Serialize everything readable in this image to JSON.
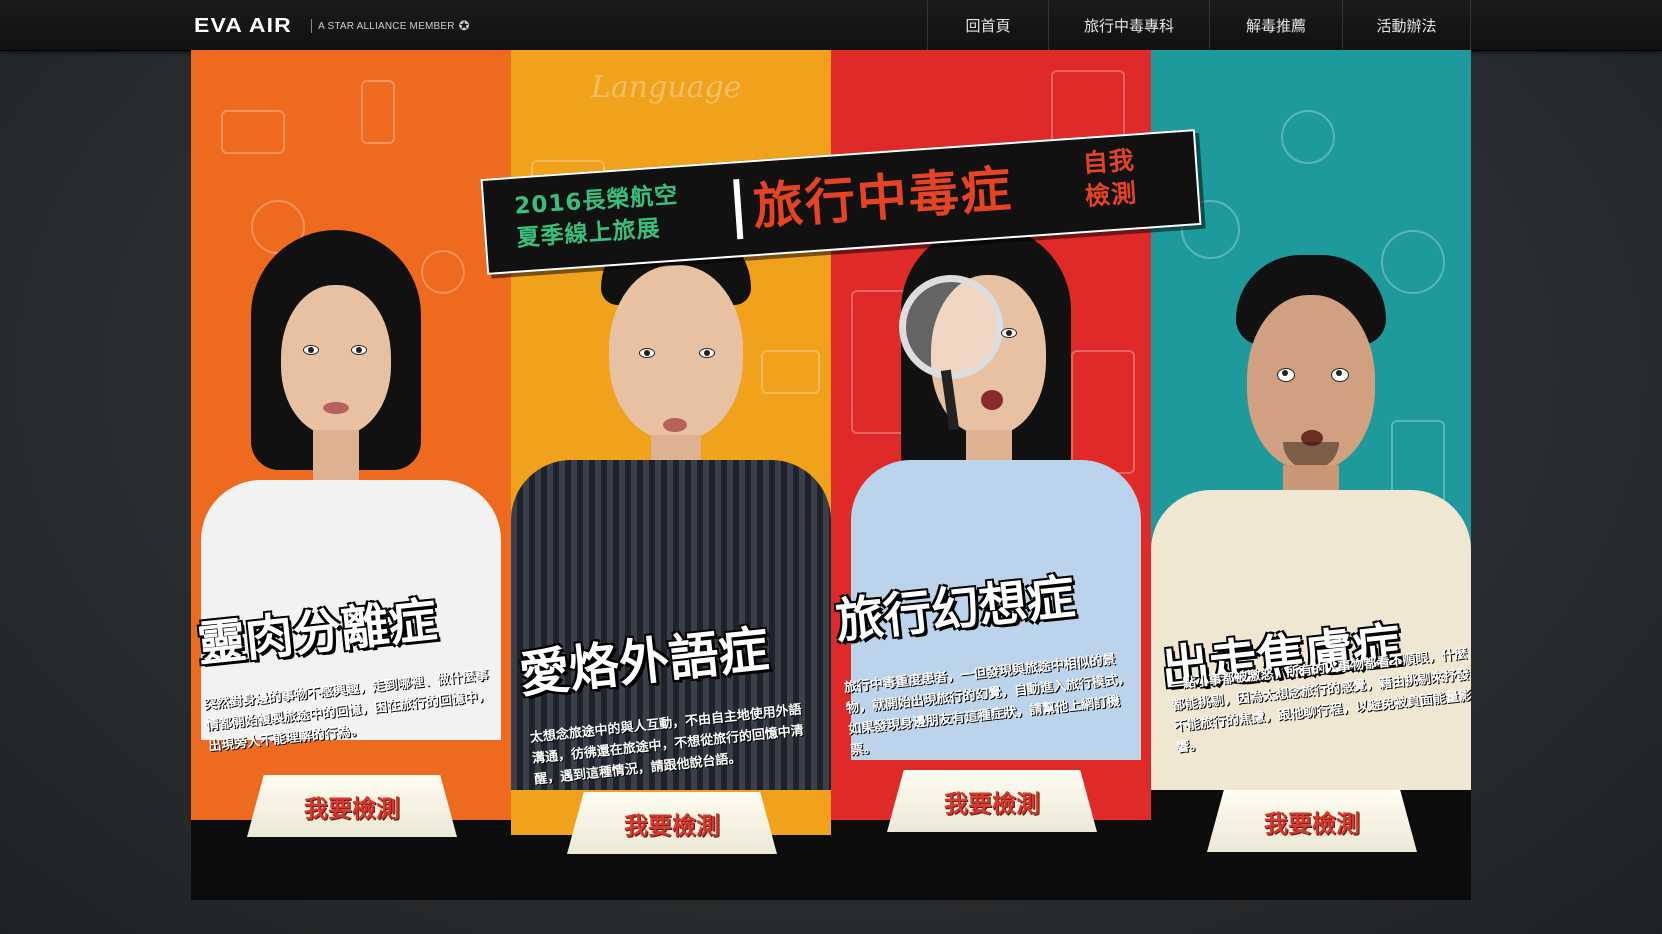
{
  "header": {
    "logo": "EVA AIR",
    "tagline": "A STAR ALLIANCE MEMBER",
    "nav": [
      "回首頁",
      "旅行中毒專科",
      "解毒推薦",
      "活動辦法"
    ]
  },
  "banner": {
    "line1": "2016長榮航空",
    "line2": "夏季線上旅展",
    "main": "旅行中毒症",
    "side_line1": "自我",
    "side_line2": "檢測"
  },
  "panels": [
    {
      "title": "靈肉分離症",
      "desc": "突然對身邊的事物不感興趣，走到哪裡、做什麼事情都開始複製旅途中的回憶，困在旅行的回憶中，出現旁人不能理解的行為。",
      "button": "我要檢測",
      "background_color": "#ee6a1e",
      "doodle_word": ""
    },
    {
      "title": "愛烙外語症",
      "desc": "太想念旅途中的與人互動，不由自主地使用外語溝通，彷彿還在旅途中，不想從旅行的回憶中清醒，遇到這種情況，請跟他說台語。",
      "button": "我要檢測",
      "background_color": "#f0a21c",
      "doodle_word": "Language"
    },
    {
      "title": "旅行幻想症",
      "desc": "旅行中毒重度患者，一但發現與旅途中相似的景物，就開始出現旅行的幻覺，自動進入旅行模式，如果發現身邊朋友有這種症狀，請幫他上網訂機票。",
      "button": "我要檢測",
      "background_color": "#e02a2a",
      "doodle_word": ""
    },
    {
      "title": "出走焦慮症",
      "desc": "一點小事都被激怒，所有的人事物都看不順眼，什麼都能挑剔，因為太想念旅行的感覺，藉由挑剔來抒發不能旅行的焦慮，跟他聊行程，以避免被負面能量影響。",
      "button": "我要檢測",
      "background_color": "#1e9a9c",
      "doodle_word": ""
    }
  ]
}
